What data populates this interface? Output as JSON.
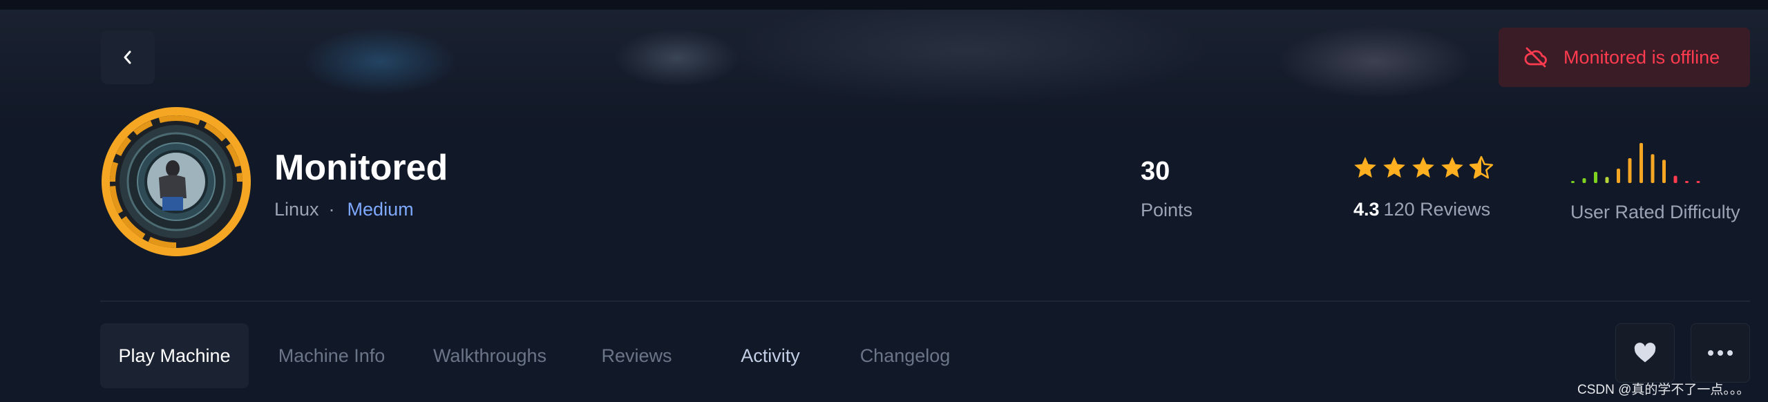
{
  "header": {
    "back_icon": "chevron-left-icon",
    "status": {
      "icon": "cloud-off-icon",
      "text": "Monitored is offline",
      "color": "#ff3b4f"
    }
  },
  "machine": {
    "name": "Monitored",
    "os": "Linux",
    "separator": "·",
    "difficulty": "Medium",
    "avatar_icon": "machine-avatar-icon"
  },
  "stats": {
    "points": {
      "value": "30",
      "label": "Points"
    },
    "rating": {
      "value": "4.3",
      "reviews": "120 Reviews",
      "stars": 4.3,
      "star_color": "#ffb020"
    },
    "user_difficulty": {
      "label": "User Rated Difficulty",
      "bar_levels": [
        0.03,
        0.12,
        0.28,
        0.15,
        0.36,
        0.62,
        1.0,
        0.72,
        0.58,
        0.18,
        0.05,
        0.05
      ]
    }
  },
  "tabs": [
    {
      "label": "Play Machine",
      "active": true
    },
    {
      "label": "Machine Info",
      "active": false
    },
    {
      "label": "Walkthroughs",
      "active": false
    },
    {
      "label": "Reviews",
      "active": false
    },
    {
      "label": "Activity",
      "active": false
    },
    {
      "label": "Changelog",
      "active": false
    }
  ],
  "actions": {
    "favorite_icon": "heart-icon",
    "more_icon": "more-horizontal-icon"
  },
  "watermark": "CSDN @真的学不了一点。。。"
}
